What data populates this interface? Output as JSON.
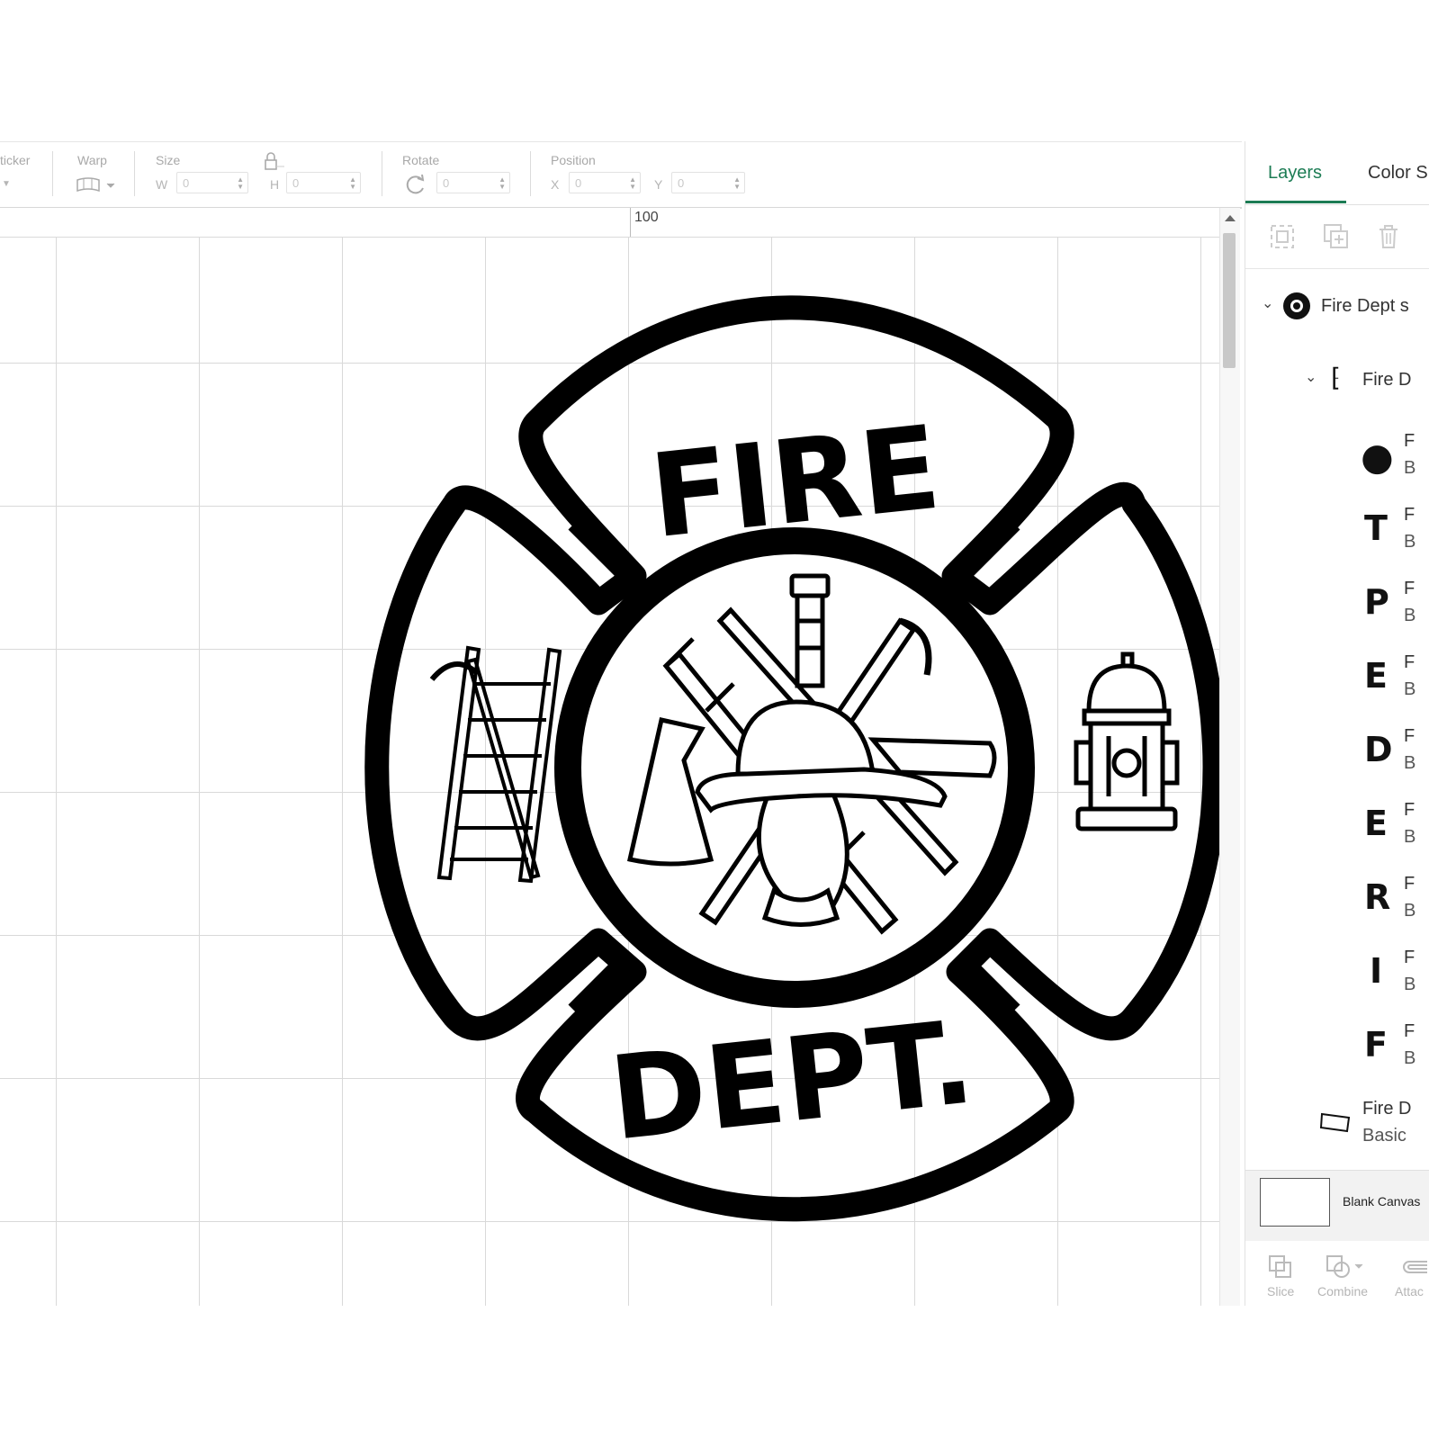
{
  "toolbar": {
    "sticker_label": "ticker",
    "warp_label": "Warp",
    "size_label": "Size",
    "width_prefix": "W",
    "width_value": "0",
    "height_prefix": "H",
    "height_value": "0",
    "rotate_label": "Rotate",
    "rotate_value": "0",
    "position_label": "Position",
    "x_prefix": "X",
    "x_value": "0",
    "y_prefix": "Y",
    "y_value": "0"
  },
  "ruler": {
    "label": "100"
  },
  "emblem": {
    "top_text": "FIRE",
    "bottom_text": "DEPT."
  },
  "panel": {
    "tabs": [
      {
        "label": "Layers"
      },
      {
        "label": "Color S"
      }
    ],
    "accent_color": "#1c7c54",
    "group": {
      "label": "Fire Dept s"
    },
    "subgroup": {
      "label": "Fire D"
    },
    "layers": [
      {
        "thumb": "●",
        "title": "F",
        "sub": "B"
      },
      {
        "thumb": "T",
        "title": "F",
        "sub": "B"
      },
      {
        "thumb": "P",
        "title": "F",
        "sub": "B"
      },
      {
        "thumb": "E",
        "title": "F",
        "sub": "B"
      },
      {
        "thumb": "D",
        "title": "F",
        "sub": "B"
      },
      {
        "thumb": "E",
        "title": "F",
        "sub": "B"
      },
      {
        "thumb": "R",
        "title": "F",
        "sub": "B"
      },
      {
        "thumb": "I",
        "title": "F",
        "sub": "B"
      },
      {
        "thumb": "F",
        "title": "F",
        "sub": "B"
      }
    ],
    "basic_layer": {
      "title": "Fire D",
      "sub": "Basic"
    },
    "blank_canvas": "Blank Canvas",
    "bottom_actions": [
      {
        "label": "Slice"
      },
      {
        "label": "Combine"
      },
      {
        "label": "Attac"
      }
    ]
  }
}
